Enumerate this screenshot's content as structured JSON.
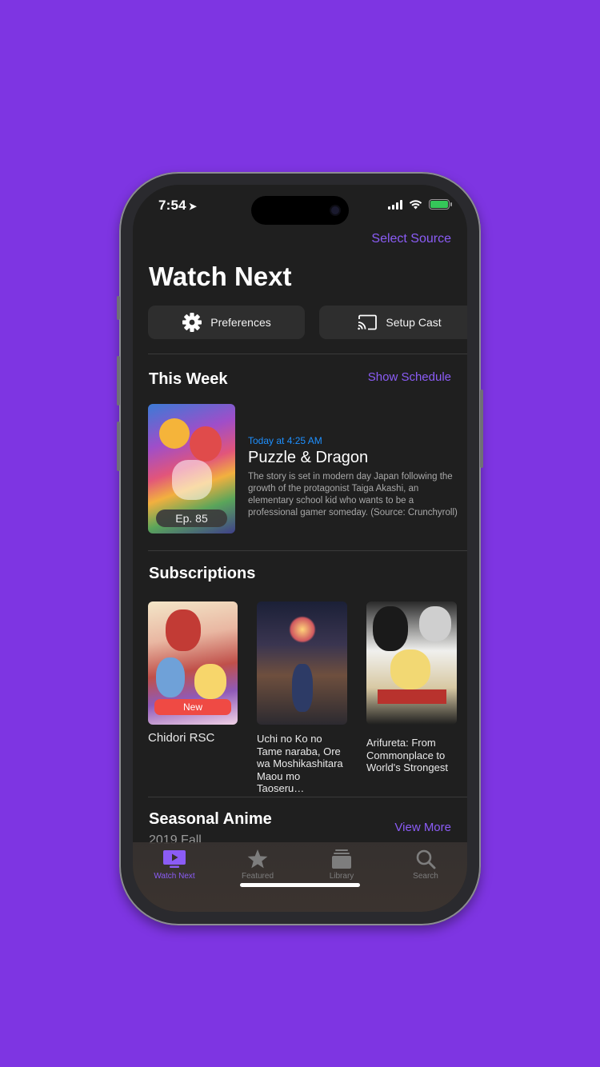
{
  "colors": {
    "background": "#7e35e2",
    "accent": "#8b5cf6",
    "time_blue": "#1e90ff",
    "new_badge": "#ef4a44",
    "screen": "#1f1f1f"
  },
  "status_bar": {
    "time": "7:54",
    "location_icon": "location-arrow-icon",
    "signal_icon": "cellular-signal-icon",
    "wifi_icon": "wifi-icon",
    "battery_icon": "battery-charging-icon"
  },
  "header": {
    "select_source": "Select Source",
    "title": "Watch Next"
  },
  "actions": {
    "preferences_label": "Preferences",
    "preferences_icon": "gear-icon",
    "setup_cast_label": "Setup Cast",
    "setup_cast_icon": "cast-icon"
  },
  "this_week": {
    "heading": "This Week",
    "link": "Show Schedule",
    "item": {
      "episode": "Ep. 85",
      "when": "Today at 4:25 AM",
      "title": "Puzzle & Dragon",
      "description": "The story is set in modern day Japan following the growth of the protagonist Taiga Akashi, an elementary school kid who wants to be a professional gamer someday. (Source: Crunchyroll)"
    }
  },
  "subscriptions": {
    "heading": "Subscriptions",
    "items": [
      {
        "title": "Chidori RSC",
        "badge": "New"
      },
      {
        "title": "Uchi no Ko no Tame naraba, Ore wa Moshikashitara Maou mo Taoseru…"
      },
      {
        "title": "Arifureta: From Commonplace to World's Strongest"
      }
    ]
  },
  "seasonal": {
    "heading": "Seasonal Anime",
    "season": "2019 Fall",
    "link": "View More"
  },
  "tabs": [
    {
      "label": "Watch Next",
      "icon": "tv-play-icon",
      "active": true
    },
    {
      "label": "Featured",
      "icon": "star-icon",
      "active": false
    },
    {
      "label": "Library",
      "icon": "library-stack-icon",
      "active": false
    },
    {
      "label": "Search",
      "icon": "search-icon",
      "active": false
    }
  ]
}
